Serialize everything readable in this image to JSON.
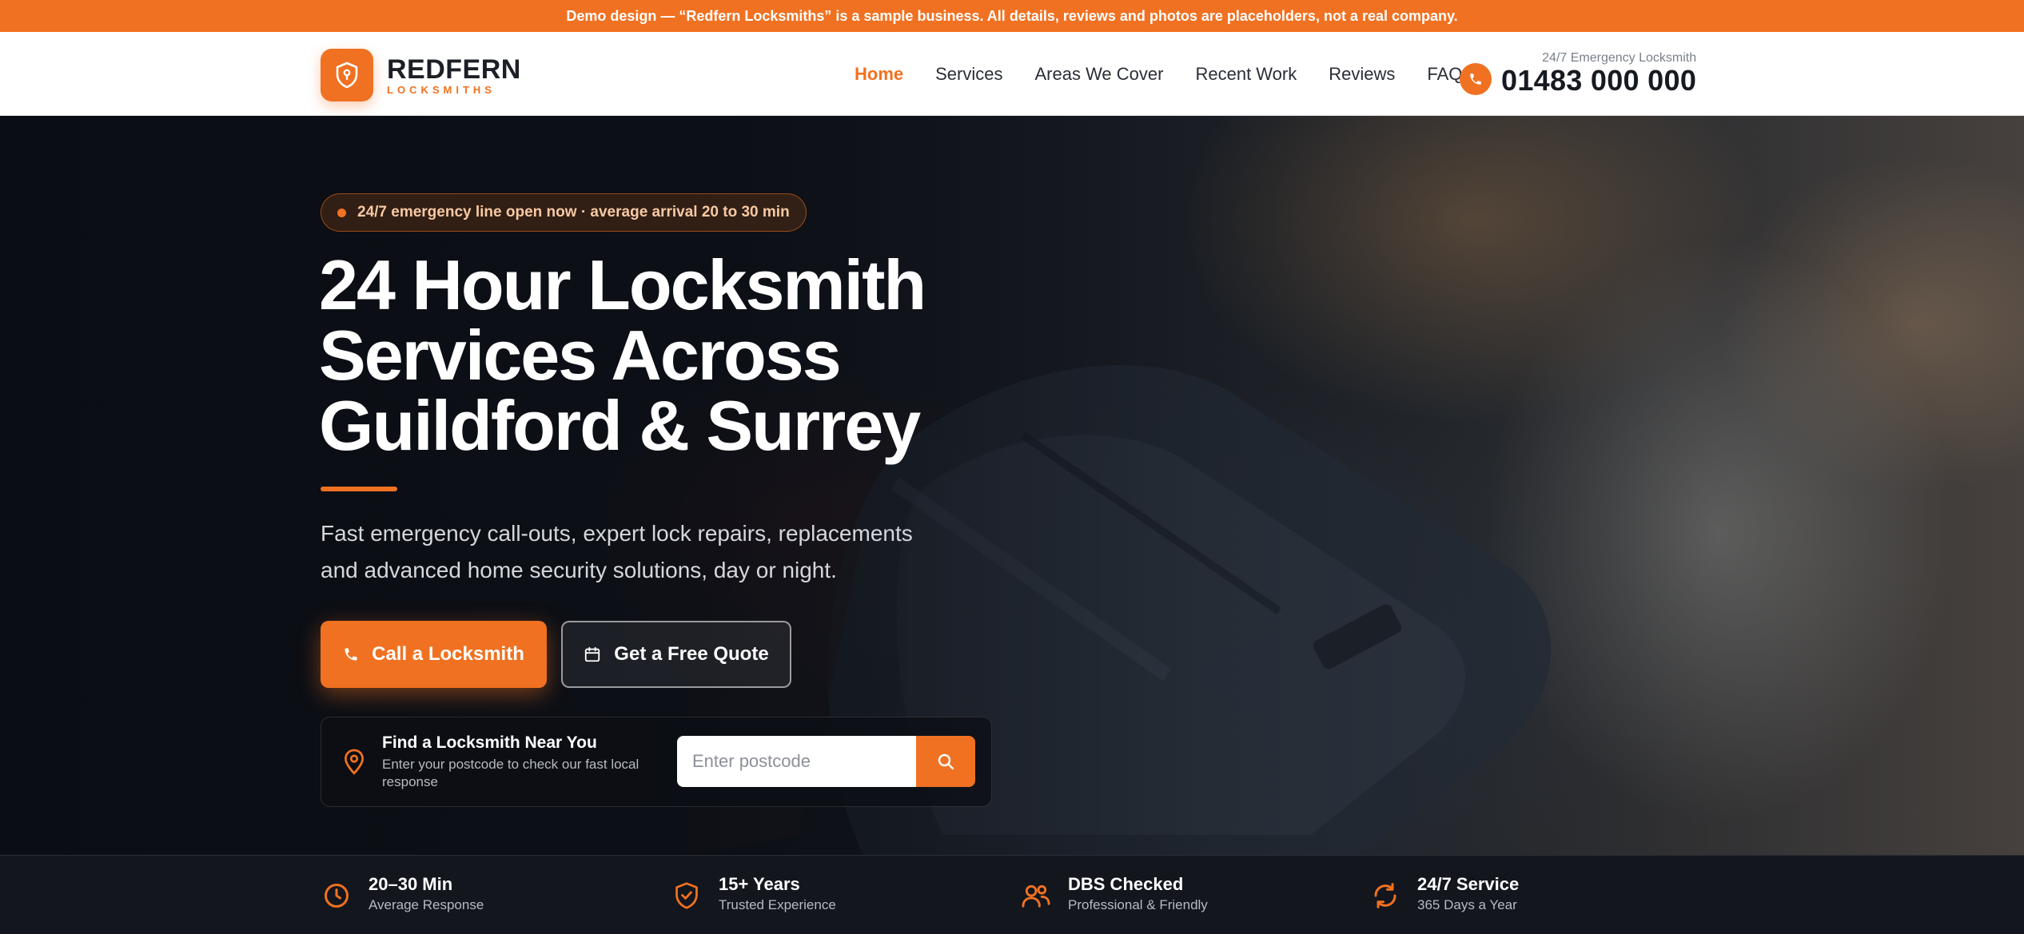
{
  "demo_banner": "Demo design — “Redfern Locksmiths” is a sample business. All details, reviews and photos are placeholders, not a real company.",
  "brand": {
    "name": "REDFERN",
    "tagline": "LOCKSMITHS",
    "accent": "#f07121"
  },
  "nav": {
    "items": [
      {
        "label": "Home",
        "active": true
      },
      {
        "label": "Services",
        "active": false
      },
      {
        "label": "Areas We Cover",
        "active": false
      },
      {
        "label": "Recent Work",
        "active": false
      },
      {
        "label": "Reviews",
        "active": false
      },
      {
        "label": "FAQ",
        "active": false
      }
    ]
  },
  "phone": {
    "label": "24/7 Emergency Locksmith",
    "number": "01483 000 000",
    "icon": "phone-icon"
  },
  "hero": {
    "status_pill": "24/7 emergency line open now · average arrival 20 to 30 min",
    "headline_lines": [
      "24 Hour Locksmith",
      "Services Across",
      "Guildford & Surrey"
    ],
    "subhead": "Fast emergency call-outs, expert lock repairs, replacements and advanced home security solutions, day or night.",
    "cta_primary": "Call a Locksmith",
    "cta_secondary": "Get a Free Quote"
  },
  "finder": {
    "title": "Find a Locksmith Near You",
    "description": "Enter your postcode to check our fast local response",
    "placeholder": "Enter postcode",
    "value": ""
  },
  "stats": [
    {
      "title": "20–30 Min",
      "subtitle": "Average Response",
      "icon": "clock-icon"
    },
    {
      "title": "15+ Years",
      "subtitle": "Trusted Experience",
      "icon": "shield-check-icon"
    },
    {
      "title": "DBS Checked",
      "subtitle": "Professional & Friendly",
      "icon": "users-icon"
    },
    {
      "title": "24/7 Service",
      "subtitle": "365 Days a Year",
      "icon": "refresh-icon"
    }
  ]
}
